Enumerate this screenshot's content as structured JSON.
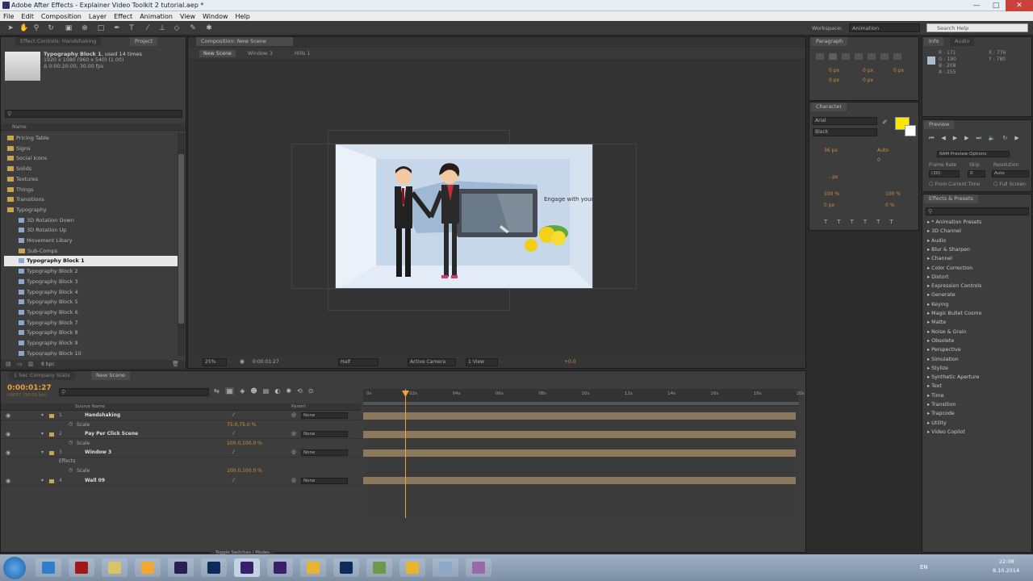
{
  "window": {
    "title": "Adobe After Effects - Explainer Video Toolkit 2 tutorial.aep *"
  },
  "menu": [
    "File",
    "Edit",
    "Composition",
    "Layer",
    "Effect",
    "Animation",
    "View",
    "Window",
    "Help"
  ],
  "toolbar": {
    "workspace_label": "Workspace:",
    "workspace_value": "Animation",
    "search_placeholder": "Search Help"
  },
  "project_panel": {
    "tab_effect_controls": "Effect Controls: Handshaking",
    "tab_project": "Project",
    "item_name": "Typography Block 1",
    "item_used": ", used 14 times",
    "item_line1": "1920 x 1080  (960 x 540) (1.00)",
    "item_line2": "Δ 0:00:20:00, 30.00 fps",
    "col_name": "Name",
    "bpc": "8 bpc",
    "items": [
      {
        "label": "Pricing Table",
        "kind": "folder",
        "indent": 0
      },
      {
        "label": "Signs",
        "kind": "folder",
        "indent": 0
      },
      {
        "label": "Social Icons",
        "kind": "folder",
        "indent": 0
      },
      {
        "label": "Solids",
        "kind": "folder",
        "indent": 0
      },
      {
        "label": "Textures",
        "kind": "folder",
        "indent": 0
      },
      {
        "label": "Things",
        "kind": "folder",
        "indent": 0
      },
      {
        "label": "Transitions",
        "kind": "folder",
        "indent": 0
      },
      {
        "label": "Typography",
        "kind": "folder",
        "indent": 0
      },
      {
        "label": "3D Rotation Down",
        "kind": "comp",
        "indent": 1
      },
      {
        "label": "3D Rotation Up",
        "kind": "comp",
        "indent": 1
      },
      {
        "label": "Movement Libary",
        "kind": "comp",
        "indent": 1
      },
      {
        "label": "Sub-Comps",
        "kind": "folder",
        "indent": 1
      },
      {
        "label": "Typography Block 1",
        "kind": "comp",
        "indent": 1,
        "selected": true
      },
      {
        "label": "Typography Block 2",
        "kind": "comp",
        "indent": 1
      },
      {
        "label": "Typography Block 3",
        "kind": "comp",
        "indent": 1
      },
      {
        "label": "Typography Block 4",
        "kind": "comp",
        "indent": 1
      },
      {
        "label": "Typography Block 5",
        "kind": "comp",
        "indent": 1
      },
      {
        "label": "Typography Block 6",
        "kind": "comp",
        "indent": 1
      },
      {
        "label": "Typography Block 7",
        "kind": "comp",
        "indent": 1
      },
      {
        "label": "Typography Block 8",
        "kind": "comp",
        "indent": 1
      },
      {
        "label": "Typography Block 9",
        "kind": "comp",
        "indent": 1
      },
      {
        "label": "Typography Block 10",
        "kind": "comp",
        "indent": 1
      }
    ]
  },
  "composition": {
    "tab": "Composition: New Scene",
    "breadcrumbs": [
      "New Scene",
      "Window 3",
      "Hills 1"
    ],
    "zoom": "25%",
    "timecode": "0:00:01:27",
    "resolution": "Half",
    "camera": "Active Camera",
    "view": "1 View",
    "exposure": "+0.0",
    "scene_text": "Engage with your own text."
  },
  "paragraph": {
    "tab": "Paragraph",
    "vals": [
      "0 px",
      "0 px",
      "0 px",
      "0 px",
      "0 px"
    ]
  },
  "character": {
    "tab": "Character",
    "font": "Arial",
    "style": "Black",
    "size": "36 px",
    "leading": "Auto",
    "tracking": "0",
    "stroke": "- px",
    "vscale": "100 %",
    "hscale": "100 %",
    "baseline": "0 px",
    "tsume": "0 %",
    "fill_color": "#ffe600"
  },
  "info": {
    "tab_info": "Info",
    "tab_audio": "Audio",
    "r": "R : 171",
    "g": "G : 190",
    "b": "B : 208",
    "a": "A : 255",
    "x": "X : 776",
    "y": "Y : 780"
  },
  "preview": {
    "tab": "Preview",
    "ram_options": "RAM Preview Options",
    "frame_rate_label": "Frame Rate",
    "skip_label": "Skip",
    "resolution_label": "Resolution",
    "frame_rate": "(30)",
    "skip": "0",
    "resolution": "Auto",
    "from_current": "From Current Time",
    "full_screen": "Full Screen"
  },
  "effects_presets": {
    "tab": "Effects & Presets",
    "items": [
      "* Animation Presets",
      "3D Channel",
      "Audio",
      "Blur & Sharpen",
      "Channel",
      "Color Correction",
      "Distort",
      "Expression Controls",
      "Generate",
      "Keying",
      "Magic Bullet Cosmo",
      "Matte",
      "Noise & Grain",
      "Obsolete",
      "Perspective",
      "Simulation",
      "Stylize",
      "Synthetic Aperture",
      "Text",
      "Time",
      "Transition",
      "Trapcode",
      "Utility",
      "Video Copilot"
    ]
  },
  "timeline": {
    "tab1": "1 Sec Company Stats",
    "tab2": "New Scene",
    "timecode": "0:00:01:27",
    "timecode_sub": "00057 (30.00 fps)",
    "col_source": "Source Name",
    "col_parent": "Parent",
    "layers": [
      {
        "num": "1",
        "name": "Handshaking",
        "parent": "None",
        "child": "Scale",
        "child_val": "75.0,75.0 %"
      },
      {
        "num": "2",
        "name": "Pay Per Click Scene",
        "parent": "None",
        "child": "Scale",
        "child_val": "100.0,100.0 %"
      },
      {
        "num": "3",
        "name": "Window 3",
        "parent": "None",
        "child": "Effects",
        "child2": "Scale",
        "child_val": "100.0,100.0 %"
      },
      {
        "num": "4",
        "name": "Wall 09",
        "parent": "None"
      }
    ],
    "ruler": [
      "0s",
      "02s",
      "04s",
      "06s",
      "08s",
      "10s",
      "12s",
      "14s",
      "16s",
      "18s",
      "20s"
    ],
    "toggle": "Toggle Switches / Modes"
  },
  "taskbar": {
    "clock": "22:08",
    "date": "8.10.2014",
    "lang": "EN",
    "apps": [
      "ie",
      "acrobat",
      "explorer",
      "media",
      "animate",
      "photoshop",
      "aftereffects-active",
      "aftereffects",
      "chrome",
      "photoshop2",
      "landscape",
      "chrome2",
      "files",
      "recorder"
    ]
  }
}
